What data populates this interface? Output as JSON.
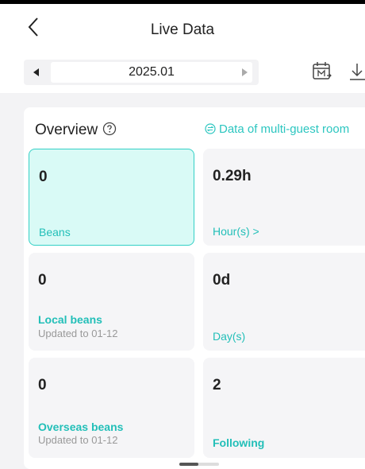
{
  "header": {
    "title": "Live Data"
  },
  "date_bar": {
    "value": "2025.01"
  },
  "overview": {
    "title": "Overview",
    "multi_guest_link": "Data of multi-guest room"
  },
  "cards": [
    {
      "value": "0",
      "label": "Beans",
      "sub": ""
    },
    {
      "value": "0.29h",
      "label": "Hour(s) >",
      "sub": ""
    },
    {
      "value": "0",
      "label": "Local beans",
      "sub": "Updated to 01-12"
    },
    {
      "value": "0d",
      "label": "Day(s)",
      "sub": ""
    },
    {
      "value": "0",
      "label": "Overseas beans",
      "sub": "Updated to 01-12"
    },
    {
      "value": "2",
      "label": "Following",
      "sub": ""
    }
  ],
  "colors": {
    "accent": "#2cc6c0",
    "active_card_bg": "#d9faf6",
    "card_bg": "#f5f5f7",
    "page_bg": "#f3f3f5"
  },
  "icons": [
    "back-arrow-icon",
    "triangle-left-icon",
    "triangle-right-icon",
    "calendar-month-icon",
    "download-icon",
    "help-circle-icon",
    "switch-arrows-icon"
  ]
}
